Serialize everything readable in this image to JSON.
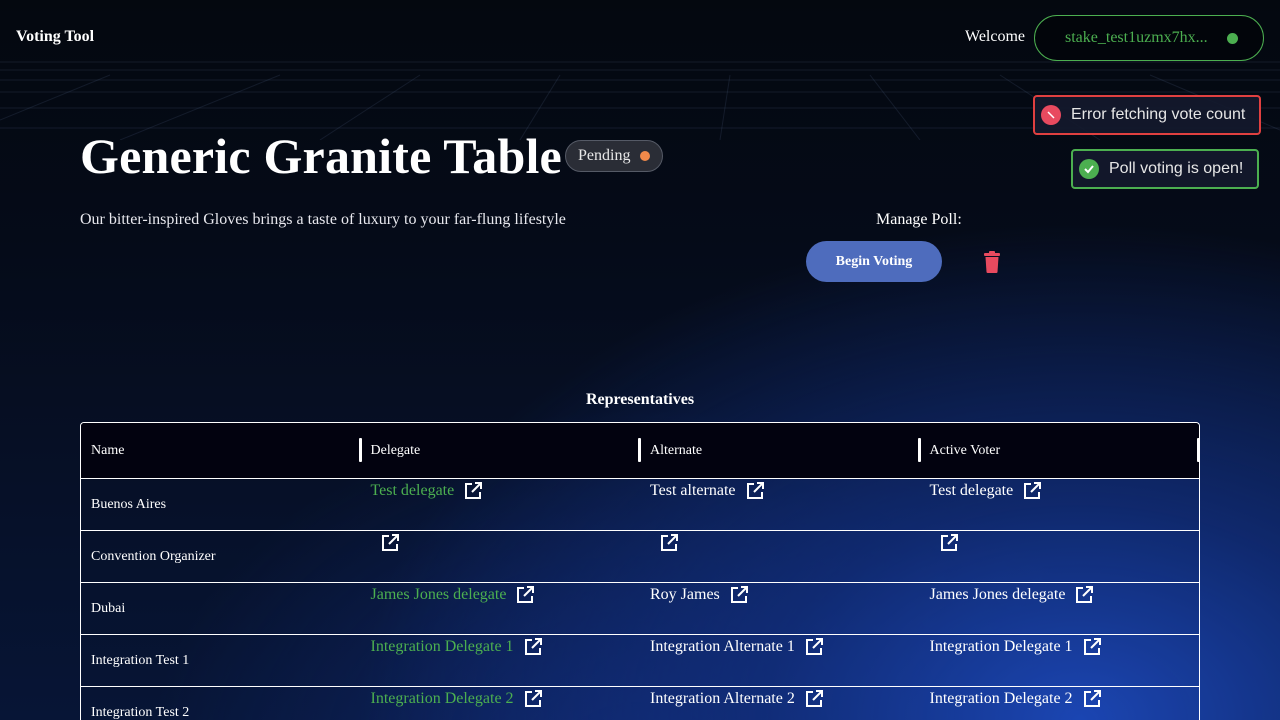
{
  "header": {
    "brand": "Voting Tool",
    "welcome": "Welcome",
    "wallet": "stake_test1uzmx7hx..."
  },
  "toasts": {
    "error": "Error fetching vote count",
    "success": "Poll voting is open!"
  },
  "poll": {
    "title": "Generic Granite Table",
    "status": "Pending",
    "description": "Our bitter-inspired Gloves brings a taste of luxury to your far-flung lifestyle",
    "manage_label": "Manage Poll:",
    "begin_button": "Begin Voting"
  },
  "representatives": {
    "title": "Representatives",
    "columns": [
      "Name",
      "Delegate",
      "Alternate",
      "Active Voter"
    ],
    "rows": [
      {
        "name": "Buenos Aires",
        "delegate": "Test delegate",
        "alternate": "Test alternate",
        "active_voter": "Test delegate"
      },
      {
        "name": "Convention Organizer",
        "delegate": "",
        "alternate": "",
        "active_voter": ""
      },
      {
        "name": "Dubai",
        "delegate": "James Jones delegate",
        "alternate": "Roy James",
        "active_voter": "James Jones delegate"
      },
      {
        "name": "Integration Test 1",
        "delegate": "Integration Delegate 1",
        "alternate": "Integration Alternate 1",
        "active_voter": "Integration Delegate 1"
      },
      {
        "name": "Integration Test 2",
        "delegate": "Integration Delegate 2",
        "alternate": "Integration Alternate 2",
        "active_voter": "Integration Delegate 2"
      }
    ]
  },
  "colors": {
    "accent_green": "#4caf50",
    "status_pending": "#f0894a",
    "error_red": "#e04040",
    "button_blue": "#4e6cbd",
    "trash_red": "#e84a5f"
  },
  "icons": {
    "external_link": "external-link-icon",
    "trash": "trash-icon",
    "error": "error-icon",
    "success": "check-circle-icon"
  }
}
